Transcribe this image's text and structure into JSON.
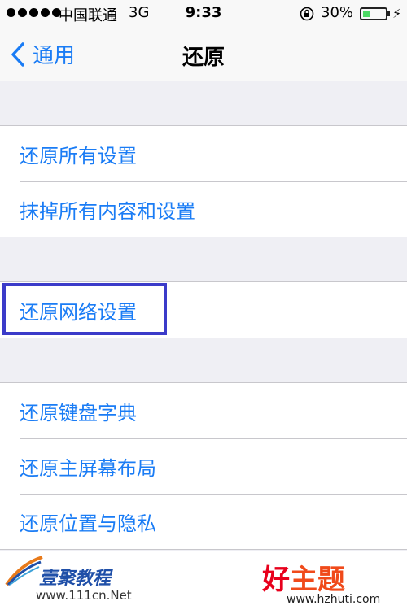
{
  "status_bar": {
    "carrier": "中国联通",
    "network": "3G",
    "time": "9:33",
    "battery_percent": "30%",
    "battery_level": 0.3,
    "battery_color": "#4cd964"
  },
  "nav": {
    "back_label": "通用",
    "title": "还原",
    "accent_color": "#1a7cf5"
  },
  "groups": [
    {
      "items": [
        "还原所有设置",
        "抹掉所有内容和设置"
      ]
    },
    {
      "items": [
        "还原网络设置"
      ]
    },
    {
      "items": [
        "还原键盘字典",
        "还原主屏幕布局",
        "还原位置与隐私"
      ]
    }
  ],
  "highlight": {
    "target": "还原网络设置",
    "color": "#3b3bc9"
  },
  "watermark": {
    "left_title": "壹聚教程",
    "left_url": "www.111cn.Net",
    "right_title_first": "好",
    "right_title_rest": "主题",
    "right_url": "www.hzhuti.com"
  }
}
